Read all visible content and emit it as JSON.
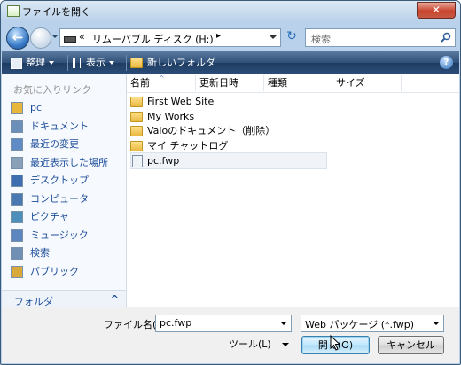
{
  "window": {
    "title": "ファイルを開く",
    "close_glyph": "✕"
  },
  "address": {
    "chevron": "«",
    "path": "リムーバブル ディスク (H:)",
    "arrow": "▸"
  },
  "search": {
    "placeholder": "検索"
  },
  "toolbar": {
    "organize": "整理",
    "views": "表示",
    "new_folder": "新しいフォルダ",
    "help_glyph": "?"
  },
  "nav": {
    "header": "お気に入りリンク",
    "items": [
      {
        "label": "pc",
        "icon": "folder-icon"
      },
      {
        "label": "ドキュメント",
        "icon": "documents-icon"
      },
      {
        "label": "最近の変更",
        "icon": "recent-icon"
      },
      {
        "label": "最近表示した場所",
        "icon": "recent-places-icon"
      },
      {
        "label": "デスクトップ",
        "icon": "desktop-icon"
      },
      {
        "label": "コンピュータ",
        "icon": "computer-icon"
      },
      {
        "label": "ピクチャ",
        "icon": "pictures-icon"
      },
      {
        "label": "ミュージック",
        "icon": "music-icon"
      },
      {
        "label": "検索",
        "icon": "searches-icon"
      },
      {
        "label": "パブリック",
        "icon": "public-icon"
      }
    ],
    "folders_label": "フォルダ",
    "folders_caret": "^"
  },
  "files": {
    "columns": [
      "名前",
      "更新日時",
      "種類",
      "サイズ"
    ],
    "sort_caret": "^",
    "rows": [
      {
        "name": "First Web Site",
        "type": "folder"
      },
      {
        "name": "My Works",
        "type": "folder"
      },
      {
        "name": "Vaioのドキュメント（削除）",
        "type": "folder"
      },
      {
        "name": "マイ チャットログ",
        "type": "folder"
      },
      {
        "name": "pc.fwp",
        "type": "file"
      }
    ]
  },
  "bottom": {
    "filename_label": "ファイル名(N):",
    "filename_value": "pc.fwp",
    "filetype_value": "Web パッケージ (*.fwp)",
    "tools_label": "ツール(L)",
    "open_label": "開く(O)",
    "cancel_label": "キャンセル"
  }
}
